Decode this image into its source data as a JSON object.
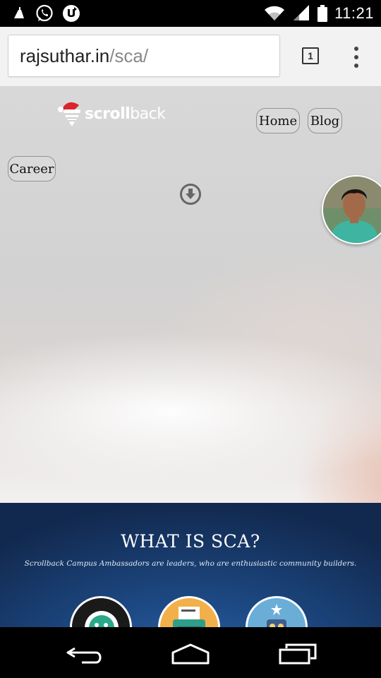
{
  "status_bar": {
    "time": "11:21",
    "icons": [
      "broom-notification-icon",
      "whatsapp-icon",
      "utorrent-icon",
      "wifi-icon",
      "cell-signal-icon",
      "battery-icon"
    ]
  },
  "browser": {
    "url_host": "rajsuthar.in",
    "url_path": "/sca/",
    "tab_count": "1",
    "icons": [
      "tabs-icon",
      "overflow-menu-icon"
    ]
  },
  "site": {
    "logo": {
      "text_bold": "scroll",
      "text_light": "back",
      "icon": "santa-hat-logo-icon"
    },
    "nav": {
      "home": "Home",
      "blog": "Blog",
      "career": "Career"
    },
    "scroll_icon": "arrow-down-circle-icon",
    "avatar": "profile-photo"
  },
  "sca_section": {
    "title": "WHAT IS SCA?",
    "subtitle": "Scrollback Campus Ambassadors are leaders, who are enthusiastic community builders.",
    "feature_icons": [
      "chat-bubble-icon",
      "typewriter-icon",
      "robot-icon"
    ]
  },
  "system_nav": {
    "icons": [
      "back-icon",
      "home-icon",
      "recents-icon"
    ]
  },
  "colors": {
    "sca_blue": "#1d4a85",
    "pill_border": "#9c8c98",
    "chrome_bg": "#f2f2f2"
  }
}
